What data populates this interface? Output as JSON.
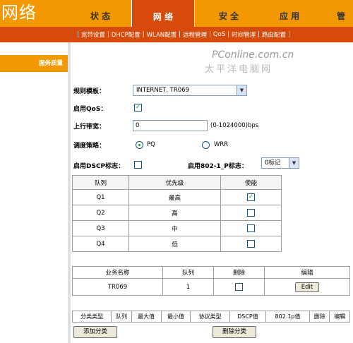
{
  "brand": "网络",
  "tabs": [
    "状 态",
    "网 络",
    "安 全",
    "应 用",
    "管"
  ],
  "subnav": [
    "宽带设置",
    "DHCP配置",
    "WLAN配置",
    "远程管理",
    "QoS",
    "时间管理",
    "路由配置"
  ],
  "sidebar": {
    "section": "服务质量"
  },
  "watermark": {
    "line1": "PConline.com.cn",
    "line2": "太平洋电脑网"
  },
  "form": {
    "rule_template_label": "规则模板：",
    "rule_template_value": "INTERNET, TR069",
    "enable_qos_label": "启用QoS：",
    "enable_qos_checked": true,
    "uplink_label": "上行带宽：",
    "uplink_value": "0",
    "uplink_hint": "(0-1024000)bps",
    "policy_label": "调度策略：",
    "policy_options": [
      "PQ",
      "WRR"
    ],
    "policy_selected": "PQ",
    "dscp_label": "启用DSCP标志：",
    "dscp_checked": false,
    "p8021_label": "启用802-1_P标志：",
    "p8021_value": "0标记"
  },
  "queue_table": {
    "headers": [
      "队列",
      "优先级",
      "使能"
    ],
    "rows": [
      {
        "queue": "Q1",
        "priority": "最高",
        "enabled": true
      },
      {
        "queue": "Q2",
        "priority": "高",
        "enabled": false
      },
      {
        "queue": "Q3",
        "priority": "中",
        "enabled": false
      },
      {
        "queue": "Q4",
        "priority": "低",
        "enabled": false
      }
    ]
  },
  "business_table": {
    "headers": [
      "业务名称",
      "队列",
      "删除",
      "编辑"
    ],
    "rows": [
      {
        "name": "TR069",
        "queue": "1",
        "delete": false,
        "edit_label": "Edit"
      }
    ]
  },
  "class_table": {
    "headers": [
      "分类类型",
      "队列",
      "最大值",
      "最小值",
      "协议类型",
      "DSCP值",
      "802.1p值",
      "删除",
      "编辑"
    ]
  },
  "buttons": {
    "add_class": "添加分类",
    "delete_class": "删除分类"
  }
}
